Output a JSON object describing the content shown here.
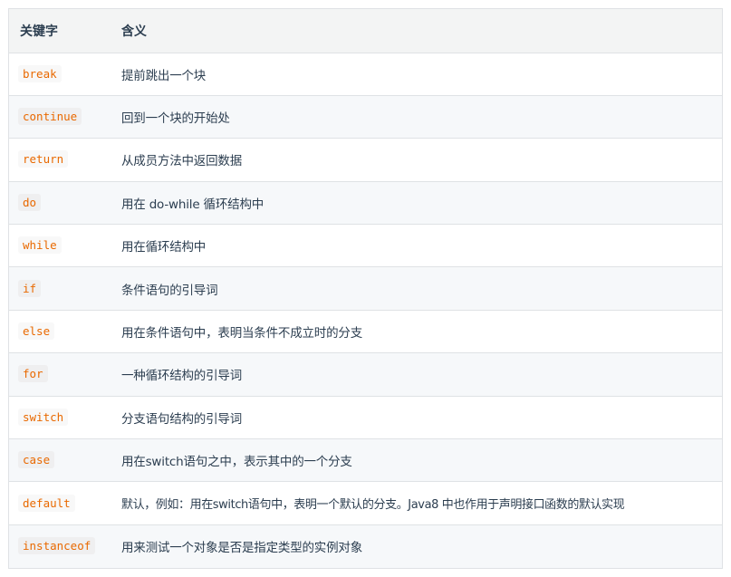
{
  "table": {
    "headers": [
      "关键字",
      "含义"
    ],
    "rows": [
      {
        "keyword": "break",
        "meaning": "提前跳出一个块"
      },
      {
        "keyword": "continue",
        "meaning": "回到一个块的开始处"
      },
      {
        "keyword": "return",
        "meaning": "从成员方法中返回数据"
      },
      {
        "keyword": "do",
        "meaning": "用在 do-while 循环结构中"
      },
      {
        "keyword": "while",
        "meaning": "用在循环结构中"
      },
      {
        "keyword": "if",
        "meaning": "条件语句的引导词"
      },
      {
        "keyword": "else",
        "meaning": "用在条件语句中，表明当条件不成立时的分支"
      },
      {
        "keyword": "for",
        "meaning": "一种循环结构的引导词"
      },
      {
        "keyword": "switch",
        "meaning": "分支语句结构的引导词"
      },
      {
        "keyword": "case",
        "meaning": "用在switch语句之中，表示其中的一个分支"
      },
      {
        "keyword": "default",
        "meaning": "默认，例如：用在switch语句中，表明一个默认的分支。Java8 中也作用于声明接口函数的默认实现"
      },
      {
        "keyword": "instanceof",
        "meaning": "用来测试一个对象是否是指定类型的实例对象"
      }
    ]
  },
  "colors": {
    "keyword": "#e96900",
    "header_bg": "#f3f4f4",
    "stripe_bg": "#f6f8fa",
    "border": "#dfe2e5"
  }
}
